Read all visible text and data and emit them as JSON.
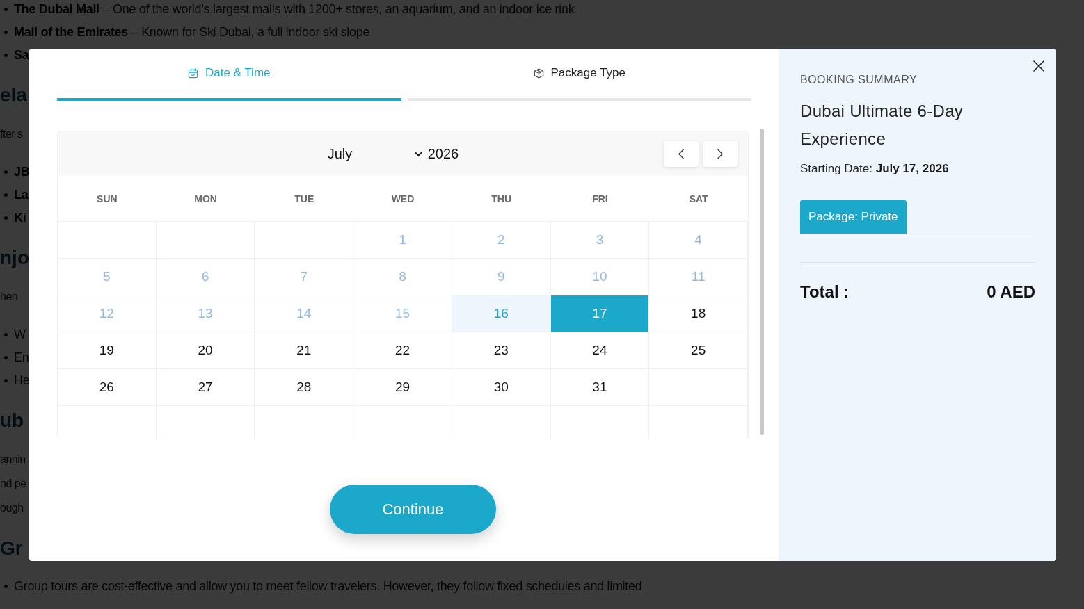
{
  "background_page": {
    "blocks": [
      {
        "kind": "bullets",
        "items": [
          "**The Dubai Mall** – One of the world’s largest malls with 1200+ stores, an aquarium, and an indoor ice rink",
          "**Mall of the Emirates** – Known for Ski Dubai, a full indoor ski slope",
          "**Sa**"
        ]
      },
      {
        "kind": "heading",
        "text": "ela"
      },
      {
        "kind": "paragraph",
        "lines": [
          "fter s"
        ]
      },
      {
        "kind": "bullets",
        "items": [
          "**JB**",
          "**La**",
          "**Ki**"
        ]
      },
      {
        "kind": "heading",
        "text": "njo"
      },
      {
        "kind": "paragraph",
        "lines": [
          "hen"
        ]
      },
      {
        "kind": "bullets",
        "items": [
          "W",
          "En",
          "He"
        ]
      },
      {
        "kind": "heading",
        "text": "ub"
      },
      {
        "kind": "paragraph",
        "lines": [
          "annin",
          "nd pe",
          "ough"
        ]
      },
      {
        "kind": "heading",
        "text": "Gr"
      },
      {
        "kind": "bullets",
        "items": [
          "Group tours are cost-effective and allow you to meet fellow travelers. However, they follow fixed schedules and limited"
        ]
      }
    ]
  },
  "booking_modal": {
    "steps": [
      {
        "kind": "date",
        "label": "Date & Time",
        "selected": true
      },
      {
        "kind": "package",
        "label": "Package Type",
        "selected": false
      }
    ],
    "calendar": {
      "month": "July",
      "year": "2026",
      "weekdays": [
        "SUN",
        "MON",
        "TUE",
        "WED",
        "THU",
        "FRI",
        "SAT"
      ],
      "weeks": [
        [
          {
            "kind": "blank"
          },
          {
            "kind": "blank"
          },
          {
            "kind": "blank"
          },
          {
            "kind": "day",
            "day": "1",
            "disabled": true,
            "today": false,
            "selected": false
          },
          {
            "kind": "day",
            "day": "2",
            "disabled": true,
            "today": false,
            "selected": false
          },
          {
            "kind": "day",
            "day": "3",
            "disabled": true,
            "today": false,
            "selected": false
          },
          {
            "kind": "day",
            "day": "4",
            "disabled": true,
            "today": false,
            "selected": false
          }
        ],
        [
          {
            "kind": "day",
            "day": "5",
            "disabled": true,
            "today": false,
            "selected": false
          },
          {
            "kind": "day",
            "day": "6",
            "disabled": true,
            "today": false,
            "selected": false
          },
          {
            "kind": "day",
            "day": "7",
            "disabled": true,
            "today": false,
            "selected": false
          },
          {
            "kind": "day",
            "day": "8",
            "disabled": true,
            "today": false,
            "selected": false
          },
          {
            "kind": "day",
            "day": "9",
            "disabled": true,
            "today": false,
            "selected": false
          },
          {
            "kind": "day",
            "day": "10",
            "disabled": true,
            "today": false,
            "selected": false
          },
          {
            "kind": "day",
            "day": "11",
            "disabled": true,
            "today": false,
            "selected": false
          }
        ],
        [
          {
            "kind": "day",
            "day": "12",
            "disabled": true,
            "today": false,
            "selected": false
          },
          {
            "kind": "day",
            "day": "13",
            "disabled": true,
            "today": false,
            "selected": false
          },
          {
            "kind": "day",
            "day": "14",
            "disabled": true,
            "today": false,
            "selected": false
          },
          {
            "kind": "day",
            "day": "15",
            "disabled": true,
            "today": false,
            "selected": false
          },
          {
            "kind": "day",
            "day": "16",
            "disabled": false,
            "today": true,
            "selected": false
          },
          {
            "kind": "day",
            "day": "17",
            "disabled": false,
            "today": false,
            "selected": true
          },
          {
            "kind": "day",
            "day": "18",
            "disabled": false,
            "today": false,
            "selected": false
          }
        ],
        [
          {
            "kind": "day",
            "day": "19",
            "disabled": false,
            "today": false,
            "selected": false
          },
          {
            "kind": "day",
            "day": "20",
            "disabled": false,
            "today": false,
            "selected": false
          },
          {
            "kind": "day",
            "day": "21",
            "disabled": false,
            "today": false,
            "selected": false
          },
          {
            "kind": "day",
            "day": "22",
            "disabled": false,
            "today": false,
            "selected": false
          },
          {
            "kind": "day",
            "day": "23",
            "disabled": false,
            "today": false,
            "selected": false
          },
          {
            "kind": "day",
            "day": "24",
            "disabled": false,
            "today": false,
            "selected": false
          },
          {
            "kind": "day",
            "day": "25",
            "disabled": false,
            "today": false,
            "selected": false
          }
        ],
        [
          {
            "kind": "day",
            "day": "26",
            "disabled": false,
            "today": false,
            "selected": false
          },
          {
            "kind": "day",
            "day": "27",
            "disabled": false,
            "today": false,
            "selected": false
          },
          {
            "kind": "day",
            "day": "28",
            "disabled": false,
            "today": false,
            "selected": false
          },
          {
            "kind": "day",
            "day": "29",
            "disabled": false,
            "today": false,
            "selected": false
          },
          {
            "kind": "day",
            "day": "30",
            "disabled": false,
            "today": false,
            "selected": false
          },
          {
            "kind": "day",
            "day": "31",
            "disabled": false,
            "today": false,
            "selected": false
          },
          {
            "kind": "blank"
          }
        ],
        [
          {
            "kind": "blank"
          },
          {
            "kind": "blank"
          },
          {
            "kind": "blank"
          },
          {
            "kind": "blank"
          },
          {
            "kind": "blank"
          },
          {
            "kind": "blank"
          },
          {
            "kind": "blank"
          }
        ]
      ]
    },
    "continue_button": "Continue",
    "summary": {
      "heading": "BOOKING SUMMARY",
      "title": "Dubai Ultimate 6-Day Experience",
      "starting_date": "Starting Date: **July 17, 2026**",
      "tabs": [
        {
          "label": "Package: Private",
          "selected": true
        }
      ],
      "total_label": "Total :",
      "total_value": "0 AED"
    }
  }
}
